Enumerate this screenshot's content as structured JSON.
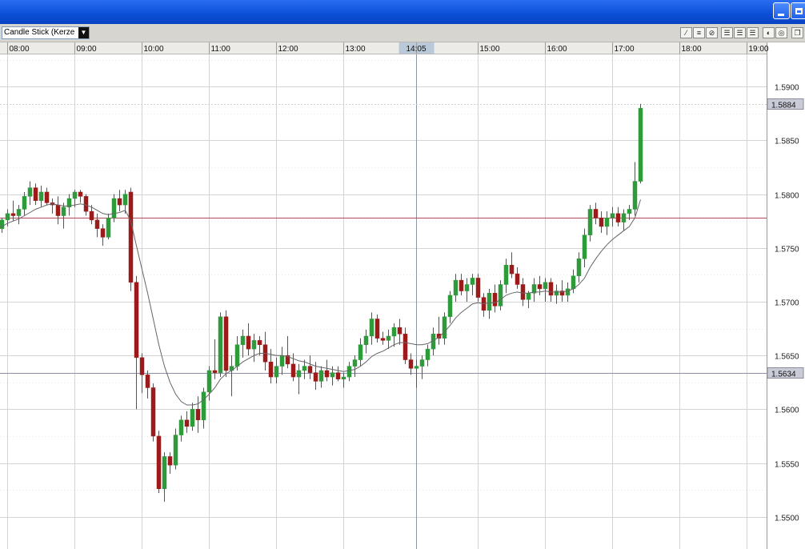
{
  "toolbar": {
    "chart_type_label": "Candle Stick (Kerze",
    "tool_icons": [
      "draw-line-icon",
      "horizontal-lines-icon",
      "fibonacci-icon",
      "grid-layout-1-icon",
      "grid-layout-2-icon",
      "grid-layout-3-icon",
      "zoom-icon",
      "settings-icon",
      "detach-window-icon"
    ]
  },
  "colors": {
    "bull": "#2e9b3a",
    "bear": "#9b1b1b",
    "ma": "#666666",
    "marker_line": "#b04a5a",
    "highlight": "#b9c9d9"
  },
  "chart_data": {
    "type": "candlestick",
    "title": "",
    "x_labels": [
      "08:00",
      "09:00",
      "10:00",
      "11:00",
      "12:00",
      "13:00",
      "14:05",
      "15:00",
      "16:00",
      "17:00",
      "18:00",
      "19:00"
    ],
    "highlighted_x_label": "14:05",
    "y_ticks": [
      "1.5500",
      "1.5550",
      "1.5600",
      "1.5650",
      "1.5700",
      "1.5750",
      "1.5800",
      "1.5850",
      "1.5900"
    ],
    "ylim": [
      1.547,
      1.593
    ],
    "price_labels": [
      {
        "value": "1.5884",
        "price": 1.5884
      },
      {
        "value": "1.5634",
        "price": 1.5634
      }
    ],
    "horizontal_line": 1.5778,
    "candles": [
      [
        1.5765,
        1.5772,
        1.5762,
        1.5768
      ],
      [
        1.5768,
        1.5778,
        1.5764,
        1.5776
      ],
      [
        1.5776,
        1.5786,
        1.577,
        1.5782
      ],
      [
        1.5782,
        1.5794,
        1.5775,
        1.578
      ],
      [
        1.578,
        1.579,
        1.5772,
        1.5786
      ],
      [
        1.5786,
        1.5802,
        1.578,
        1.5798
      ],
      [
        1.5798,
        1.5812,
        1.579,
        1.5806
      ],
      [
        1.5806,
        1.581,
        1.579,
        1.5794
      ],
      [
        1.5794,
        1.5808,
        1.5788,
        1.5802
      ],
      [
        1.5802,
        1.5806,
        1.579,
        1.5792
      ],
      [
        1.5792,
        1.5796,
        1.5782,
        1.579
      ],
      [
        1.579,
        1.5798,
        1.5772,
        1.578
      ],
      [
        1.578,
        1.5792,
        1.5768,
        1.5788
      ],
      [
        1.5788,
        1.58,
        1.578,
        1.5796
      ],
      [
        1.5796,
        1.5804,
        1.5788,
        1.5802
      ],
      [
        1.5802,
        1.5804,
        1.5792,
        1.5798
      ],
      [
        1.5798,
        1.58,
        1.578,
        1.5784
      ],
      [
        1.5784,
        1.579,
        1.5772,
        1.5776
      ],
      [
        1.5776,
        1.5782,
        1.576,
        1.5768
      ],
      [
        1.5768,
        1.5772,
        1.5752,
        1.576
      ],
      [
        1.576,
        1.5782,
        1.5758,
        1.5778
      ],
      [
        1.5778,
        1.58,
        1.5774,
        1.5796
      ],
      [
        1.5796,
        1.5804,
        1.5784,
        1.579
      ],
      [
        1.579,
        1.5804,
        1.5782,
        1.58
      ],
      [
        1.5802,
        1.5806,
        1.571,
        1.5718
      ],
      [
        1.5718,
        1.5724,
        1.56,
        1.5648
      ],
      [
        1.5648,
        1.5652,
        1.5615,
        1.5632
      ],
      [
        1.5632,
        1.5636,
        1.561,
        1.562
      ],
      [
        1.562,
        1.5624,
        1.557,
        1.5575
      ],
      [
        1.5575,
        1.558,
        1.5522,
        1.5526
      ],
      [
        1.5526,
        1.556,
        1.5514,
        1.5556
      ],
      [
        1.5556,
        1.556,
        1.554,
        1.5548
      ],
      [
        1.5548,
        1.5582,
        1.5544,
        1.5576
      ],
      [
        1.5576,
        1.5594,
        1.557,
        1.559
      ],
      [
        1.559,
        1.5598,
        1.5578,
        1.5584
      ],
      [
        1.5584,
        1.5606,
        1.558,
        1.56
      ],
      [
        1.56,
        1.5612,
        1.5578,
        1.559
      ],
      [
        1.559,
        1.562,
        1.5582,
        1.5616
      ],
      [
        1.5616,
        1.564,
        1.5608,
        1.5636
      ],
      [
        1.5636,
        1.5665,
        1.5628,
        1.5634
      ],
      [
        1.5634,
        1.569,
        1.563,
        1.5686
      ],
      [
        1.5686,
        1.5692,
        1.563,
        1.5636
      ],
      [
        1.5636,
        1.565,
        1.5612,
        1.564
      ],
      [
        1.564,
        1.5668,
        1.5636,
        1.566
      ],
      [
        1.566,
        1.5674,
        1.5648,
        1.5668
      ],
      [
        1.5668,
        1.568,
        1.565,
        1.5656
      ],
      [
        1.5656,
        1.567,
        1.5644,
        1.5664
      ],
      [
        1.5664,
        1.5668,
        1.565,
        1.566
      ],
      [
        1.566,
        1.5672,
        1.5636,
        1.5644
      ],
      [
        1.5644,
        1.5656,
        1.5624,
        1.563
      ],
      [
        1.563,
        1.5648,
        1.5624,
        1.564
      ],
      [
        1.564,
        1.5658,
        1.5632,
        1.565
      ],
      [
        1.565,
        1.5668,
        1.5638,
        1.5642
      ],
      [
        1.5642,
        1.5652,
        1.5626,
        1.563
      ],
      [
        1.563,
        1.5642,
        1.5614,
        1.5636
      ],
      [
        1.5636,
        1.5646,
        1.5628,
        1.564
      ],
      [
        1.564,
        1.565,
        1.5628,
        1.5634
      ],
      [
        1.5634,
        1.5644,
        1.5618,
        1.5626
      ],
      [
        1.5626,
        1.564,
        1.562,
        1.5636
      ],
      [
        1.5636,
        1.5646,
        1.5626,
        1.563
      ],
      [
        1.563,
        1.564,
        1.5622,
        1.5634
      ],
      [
        1.5634,
        1.564,
        1.5626,
        1.5628
      ],
      [
        1.5628,
        1.5634,
        1.562,
        1.563
      ],
      [
        1.563,
        1.5644,
        1.5626,
        1.564
      ],
      [
        1.564,
        1.565,
        1.563,
        1.5646
      ],
      [
        1.5646,
        1.5666,
        1.564,
        1.566
      ],
      [
        1.566,
        1.5674,
        1.5652,
        1.5668
      ],
      [
        1.5668,
        1.569,
        1.566,
        1.5684
      ],
      [
        1.5684,
        1.5688,
        1.5662,
        1.5666
      ],
      [
        1.5666,
        1.5672,
        1.566,
        1.5664
      ],
      [
        1.5664,
        1.5674,
        1.5656,
        1.5668
      ],
      [
        1.5668,
        1.568,
        1.5658,
        1.5676
      ],
      [
        1.5676,
        1.5684,
        1.566,
        1.567
      ],
      [
        1.567,
        1.5676,
        1.5642,
        1.5646
      ],
      [
        1.5646,
        1.5652,
        1.5632,
        1.5638
      ],
      [
        1.5638,
        1.5646,
        1.562,
        1.564
      ],
      [
        1.564,
        1.565,
        1.5628,
        1.5646
      ],
      [
        1.5646,
        1.566,
        1.564,
        1.5656
      ],
      [
        1.5656,
        1.5676,
        1.565,
        1.567
      ],
      [
        1.567,
        1.5686,
        1.566,
        1.5666
      ],
      [
        1.5666,
        1.569,
        1.566,
        1.5686
      ],
      [
        1.5686,
        1.571,
        1.568,
        1.5706
      ],
      [
        1.5706,
        1.5726,
        1.57,
        1.572
      ],
      [
        1.572,
        1.5726,
        1.5706,
        1.571
      ],
      [
        1.571,
        1.5722,
        1.57,
        1.5716
      ],
      [
        1.5716,
        1.5726,
        1.5706,
        1.5722
      ],
      [
        1.5722,
        1.5726,
        1.57,
        1.5704
      ],
      [
        1.5704,
        1.5708,
        1.5686,
        1.5692
      ],
      [
        1.5692,
        1.5712,
        1.5684,
        1.5708
      ],
      [
        1.5708,
        1.5716,
        1.569,
        1.5696
      ],
      [
        1.5696,
        1.572,
        1.5692,
        1.5716
      ],
      [
        1.5716,
        1.574,
        1.5708,
        1.5734
      ],
      [
        1.5734,
        1.5746,
        1.5722,
        1.5726
      ],
      [
        1.5726,
        1.5732,
        1.5712,
        1.5716
      ],
      [
        1.5716,
        1.5722,
        1.5696,
        1.5702
      ],
      [
        1.5702,
        1.571,
        1.5694,
        1.5708
      ],
      [
        1.5708,
        1.5722,
        1.57,
        1.5716
      ],
      [
        1.5716,
        1.5724,
        1.5706,
        1.5712
      ],
      [
        1.5712,
        1.5722,
        1.57,
        1.5718
      ],
      [
        1.5718,
        1.5722,
        1.57,
        1.5706
      ],
      [
        1.5706,
        1.5716,
        1.5698,
        1.571
      ],
      [
        1.571,
        1.572,
        1.57,
        1.5706
      ],
      [
        1.5706,
        1.5718,
        1.57,
        1.5712
      ],
      [
        1.5712,
        1.573,
        1.5708,
        1.5724
      ],
      [
        1.5724,
        1.5746,
        1.5718,
        1.574
      ],
      [
        1.574,
        1.5768,
        1.5732,
        1.5762
      ],
      [
        1.5762,
        1.579,
        1.5756,
        1.5786
      ],
      [
        1.5786,
        1.5792,
        1.5772,
        1.5778
      ],
      [
        1.5778,
        1.5784,
        1.5764,
        1.577
      ],
      [
        1.577,
        1.5784,
        1.5762,
        1.5778
      ],
      [
        1.5778,
        1.5788,
        1.577,
        1.5782
      ],
      [
        1.5782,
        1.5788,
        1.577,
        1.5774
      ],
      [
        1.5774,
        1.5786,
        1.5766,
        1.5782
      ],
      [
        1.5782,
        1.579,
        1.5776,
        1.5786
      ],
      [
        1.5786,
        1.583,
        1.578,
        1.5812
      ],
      [
        1.5812,
        1.5884,
        1.581,
        1.588
      ]
    ],
    "moving_average": [
      1.5768,
      1.577,
      1.5773,
      1.5775,
      1.5777,
      1.578,
      1.5783,
      1.5786,
      1.5788,
      1.579,
      1.5791,
      1.579,
      1.5789,
      1.5789,
      1.579,
      1.5791,
      1.579,
      1.5788,
      1.5785,
      1.5782,
      1.5781,
      1.5782,
      1.5783,
      1.5785,
      1.5775,
      1.5752,
      1.573,
      1.5708,
      1.5684,
      1.566,
      1.564,
      1.5625,
      1.5614,
      1.5607,
      1.5604,
      1.5604,
      1.5605,
      1.5609,
      1.5614,
      1.562,
      1.5628,
      1.5633,
      1.5636,
      1.564,
      1.5644,
      1.5647,
      1.565,
      1.5652,
      1.5652,
      1.5651,
      1.565,
      1.565,
      1.5649,
      1.5647,
      1.5645,
      1.5644,
      1.5642,
      1.564,
      1.5639,
      1.5638,
      1.5637,
      1.5636,
      1.5635,
      1.5636,
      1.5637,
      1.564,
      1.5644,
      1.5649,
      1.5652,
      1.5654,
      1.5657,
      1.566,
      1.5662,
      1.5662,
      1.5661,
      1.566,
      1.566,
      1.5661,
      1.5664,
      1.5667,
      1.5672,
      1.5678,
      1.5685,
      1.569,
      1.5694,
      1.5698,
      1.5699,
      1.5698,
      1.5699,
      1.5699,
      1.5702,
      1.5706,
      1.5708,
      1.5709,
      1.5708,
      1.5708,
      1.5709,
      1.5709,
      1.571,
      1.5709,
      1.5709,
      1.5709,
      1.571,
      1.5712,
      1.5716,
      1.5722,
      1.5732,
      1.574,
      1.5747,
      1.5753,
      1.5758,
      1.5762,
      1.5766,
      1.577,
      1.5778,
      1.5795
    ]
  }
}
